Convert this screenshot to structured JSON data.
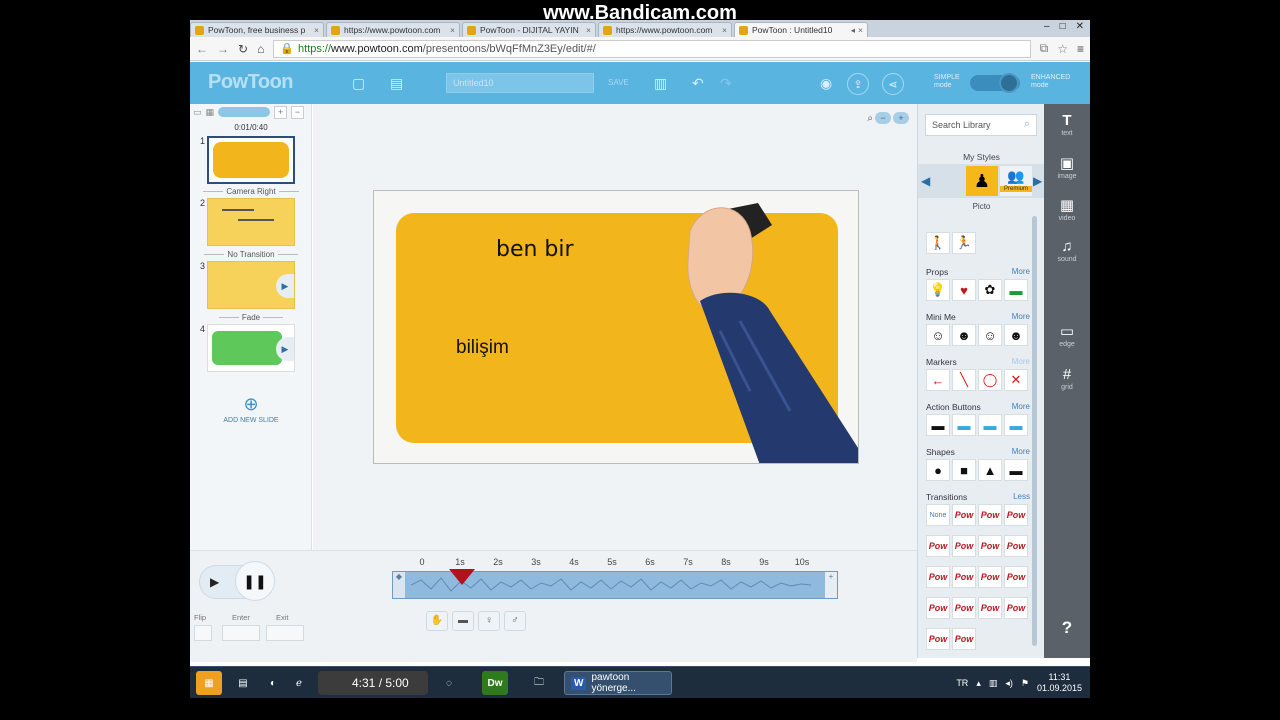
{
  "watermark": "www.Bandicam.com",
  "browser": {
    "tabs": [
      {
        "label": "PowToon, free business p",
        "active": false
      },
      {
        "label": "https://www.powtoon.com",
        "active": false
      },
      {
        "label": "PowToon - DIJITAL YAYIN",
        "active": false
      },
      {
        "label": "https://www.powtoon.com",
        "active": false
      },
      {
        "label": "PowToon : Untitled10",
        "active": true
      }
    ],
    "url_prefix": "https://",
    "url_host": "www.powtoon.com",
    "url_path": "/presentoons/bWqFfMnZ3Ey/edit/#/"
  },
  "header": {
    "logo": "PowToon",
    "title_value": "Untitled10",
    "save_label": "SAVE",
    "mode_simple_1": "SIMPLE",
    "mode_simple_2": "mode",
    "mode_enh_1": "ENHANCED",
    "mode_enh_2": "mode"
  },
  "slides": {
    "time": "0:01/0:40",
    "items": [
      {
        "num": "1",
        "transition": "Camera Right"
      },
      {
        "num": "2",
        "transition": "No Transition"
      },
      {
        "num": "3",
        "transition": "Fade"
      },
      {
        "num": "4",
        "transition": ""
      }
    ],
    "add_label": "ADD NEW SLIDE"
  },
  "canvas": {
    "text1": "ben bir",
    "text2": "bilişim"
  },
  "timeline": {
    "ticks": [
      "0",
      "1s",
      "2s",
      "3s",
      "4s",
      "5s",
      "6s",
      "7s",
      "8s",
      "9s",
      "10s"
    ],
    "playhead_seconds": 1.05,
    "flip_label": "Flip",
    "enter_label": "Enter",
    "exit_label": "Exit"
  },
  "library": {
    "search_placeholder": "Search Library",
    "my_styles": "My Styles",
    "premium": "Premium",
    "picto": "Picto",
    "categories": [
      {
        "name": "Props",
        "more": "More"
      },
      {
        "name": "Mini Me",
        "more": "More"
      },
      {
        "name": "Markers",
        "more": "More"
      },
      {
        "name": "Action Buttons",
        "more": "More"
      },
      {
        "name": "Shapes",
        "more": "More"
      },
      {
        "name": "Transitions",
        "more": "Less"
      }
    ],
    "none_label": "None",
    "pow_label": "Pow"
  },
  "tools": {
    "text": "text",
    "image": "image",
    "video": "video",
    "sound": "sound",
    "edge": "edge",
    "grid": "grid",
    "help": "?"
  },
  "taskbar": {
    "rec_time": "4:31 / 5:00",
    "dw": "Dw",
    "word_task": "pawtoon yönerge...",
    "lang": "TR",
    "time": "11:31",
    "date": "01.09.2015"
  },
  "colors": {
    "header_blue": "#5ab4e0",
    "slide_yellow": "#f2b61c",
    "playhead_red": "#b3121c",
    "transition_green": "#5fc85a"
  }
}
